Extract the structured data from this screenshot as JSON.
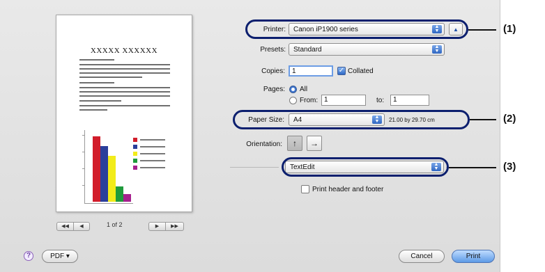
{
  "preview": {
    "doc_title": "XXXXX XXXXXX",
    "chart_colors": [
      "#d21d2b",
      "#2a3f9b",
      "#f2ec1a",
      "#1f9b3c",
      "#a6208e"
    ],
    "page_indicator": "1 of 2",
    "first_glyph": "◀◀",
    "prev_glyph": "◀",
    "next_glyph": "▶",
    "last_glyph": "▶▶"
  },
  "printer": {
    "label": "Printer:",
    "value": "Canon iP1900 series",
    "expand_glyph": "▲"
  },
  "presets": {
    "label": "Presets:",
    "value": "Standard"
  },
  "copies": {
    "label": "Copies:",
    "value": "1",
    "collated_label": "Collated",
    "collated": true
  },
  "pages": {
    "label": "Pages:",
    "all_label": "All",
    "from_label": "From:",
    "from_value": "1",
    "to_label": "to:",
    "to_value": "1"
  },
  "paper_size": {
    "label": "Paper Size:",
    "value": "A4",
    "dimensions": "21.00 by 29.70 cm"
  },
  "orientation": {
    "label": "Orientation:",
    "portrait_glyph": "↑",
    "landscape_glyph": "→"
  },
  "panel": {
    "value": "TextEdit"
  },
  "header_footer": {
    "label": "Print header and footer",
    "checked": false
  },
  "footer": {
    "help_glyph": "?",
    "pdf_label": "PDF ▾",
    "cancel_label": "Cancel",
    "print_label": "Print"
  },
  "callouts": [
    "(1)",
    "(2)",
    "(3)"
  ],
  "highlight_color": "#0c1f6e",
  "accent_color": "#2f69c6"
}
